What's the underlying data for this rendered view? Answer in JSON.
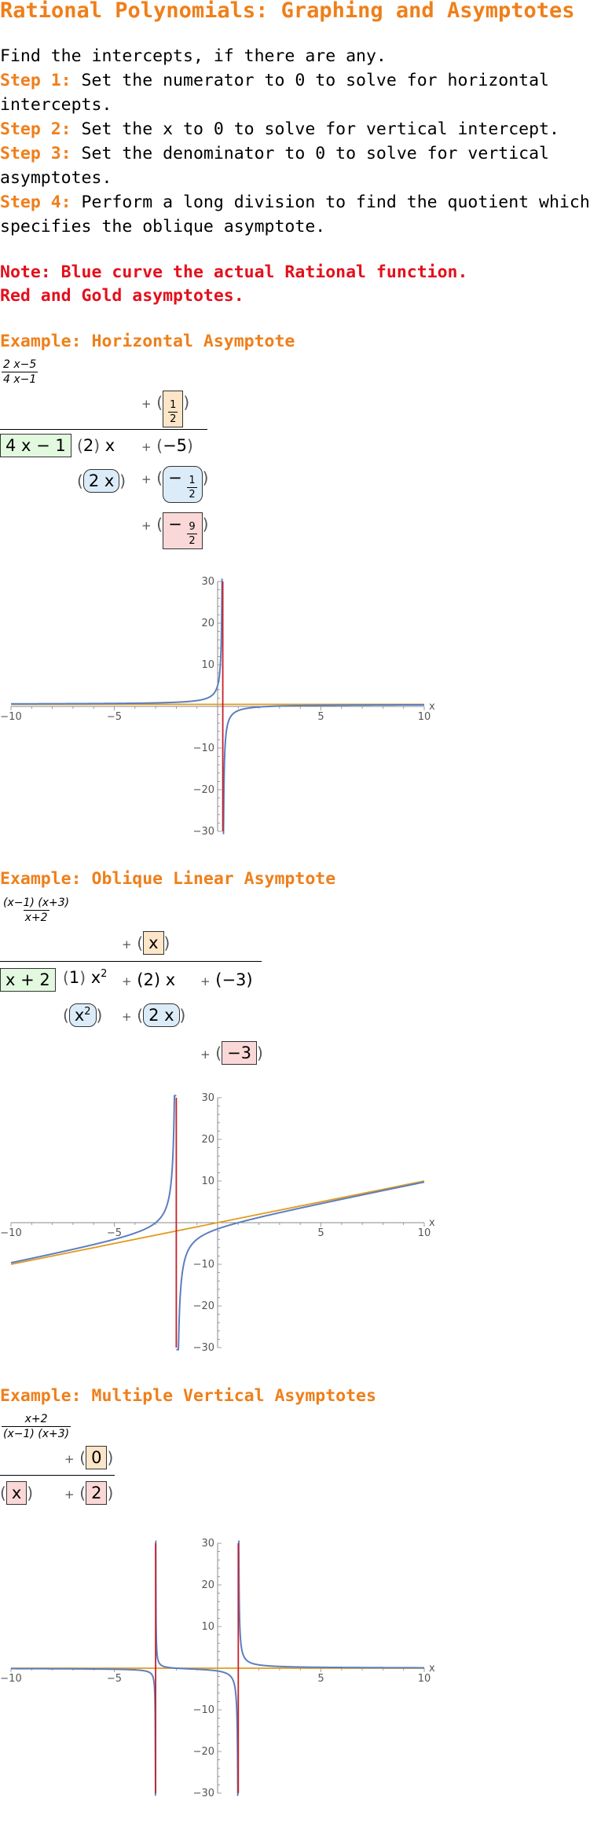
{
  "page": {
    "title": "Rational Polynomials: Graphing and Asymptotes",
    "intro": "Find the intercepts, if there are any.",
    "steps": [
      {
        "label": "Step 1:",
        "text": " Set the numerator to 0 to solve for horizontal intercepts."
      },
      {
        "label": "Step 2:",
        "text": " Set the x to 0 to solve for vertical intercept."
      },
      {
        "label": "Step 3:",
        "text": " Set the denominator to 0 to solve for vertical asymptotes."
      },
      {
        "label": "Step 4:",
        "text": " Perform a long division to find the quotient which specifies the oblique asymptote."
      }
    ],
    "note_line1": "Note: Blue curve the actual Rational function.",
    "note_line2": "Red and Gold asymptotes."
  },
  "examples": [
    {
      "title": "Example: Horizontal Asymptote",
      "function": {
        "num": "2 x−5",
        "den": "4 x−1"
      },
      "long_division": {
        "quotient": [
          "1",
          "2"
        ],
        "divisor": "4 x − 1",
        "dividend": [
          "(2) x",
          "+ (−5)"
        ],
        "subtract": [
          "2 x",
          "− 1 / 2"
        ],
        "remainder": "− 9 / 2",
        "q_num": "1",
        "q_den": "2",
        "dv_coef": "2",
        "dv_var": "x",
        "dv_plus": "+",
        "dv_const": "−5",
        "sub1": "2 x",
        "sub2_sign": "−",
        "sub2_num": "1",
        "sub2_den": "2",
        "rem_sign": "−",
        "rem_num": "9",
        "rem_den": "2",
        "plus": "+"
      }
    },
    {
      "title": "Example: Oblique Linear Asymptote",
      "function": {
        "num": "(x−1) (x+3)",
        "den": "x+2"
      },
      "long_division": {
        "quotient": "x",
        "divisor": "x + 2",
        "dv_coef": "1",
        "dv_var": "x",
        "dv_exp": "2",
        "dv_mid": "(2) x",
        "dv_const": "(−3)",
        "sub1_var": "x",
        "sub1_exp": "2",
        "sub2": "2 x",
        "remainder": "−3",
        "plus": "+"
      }
    },
    {
      "title": "Example: Multiple Vertical Asymptotes",
      "function": {
        "num": "x+2",
        "den": "(x−1) (x+3)"
      },
      "long_division": {
        "quotient": "0",
        "divisor": "x",
        "remainder": "2",
        "plus": "+"
      }
    }
  ],
  "chart_data": [
    {
      "type": "line",
      "title": "",
      "xlabel": "x",
      "ylabel": "",
      "xlim": [
        -10,
        10
      ],
      "ylim": [
        -30,
        30
      ],
      "x_ticks": [
        -10,
        -5,
        5,
        10
      ],
      "y_ticks": [
        -30,
        -20,
        -10,
        10,
        20,
        30
      ],
      "function": "(2x-5)/(4x-1)",
      "series": [
        {
          "role": "function",
          "color": "#5b7fbf"
        },
        {
          "role": "vertical asymptote",
          "x": 0.25,
          "color": "#c8202a"
        },
        {
          "role": "horizontal asymptote",
          "y": 0.5,
          "color": "#e19b20"
        }
      ]
    },
    {
      "type": "line",
      "title": "",
      "xlabel": "x",
      "ylabel": "",
      "xlim": [
        -10,
        10
      ],
      "ylim": [
        -30,
        30
      ],
      "x_ticks": [
        -10,
        -5,
        5,
        10
      ],
      "y_ticks": [
        -30,
        -20,
        -10,
        10,
        20,
        30
      ],
      "function": "(x-1)(x+3)/(x+2)",
      "series": [
        {
          "role": "function",
          "color": "#5b7fbf"
        },
        {
          "role": "vertical asymptote",
          "x": -2,
          "color": "#c8202a"
        },
        {
          "role": "oblique asymptote",
          "slope": 1,
          "intercept": 0,
          "color": "#e19b20"
        }
      ]
    },
    {
      "type": "line",
      "title": "",
      "xlabel": "x",
      "ylabel": "",
      "xlim": [
        -10,
        10
      ],
      "ylim": [
        -30,
        30
      ],
      "x_ticks": [
        -10,
        -5,
        5,
        10
      ],
      "y_ticks": [
        -30,
        -20,
        -10,
        10,
        20,
        30
      ],
      "function": "(x+2)/((x-1)(x+3))",
      "series": [
        {
          "role": "function",
          "color": "#5b7fbf"
        },
        {
          "role": "vertical asymptote",
          "x": -3,
          "color": "#c8202a"
        },
        {
          "role": "vertical asymptote",
          "x": 1,
          "color": "#c8202a"
        },
        {
          "role": "horizontal asymptote",
          "y": 0,
          "color": "#e19b20"
        }
      ]
    }
  ]
}
